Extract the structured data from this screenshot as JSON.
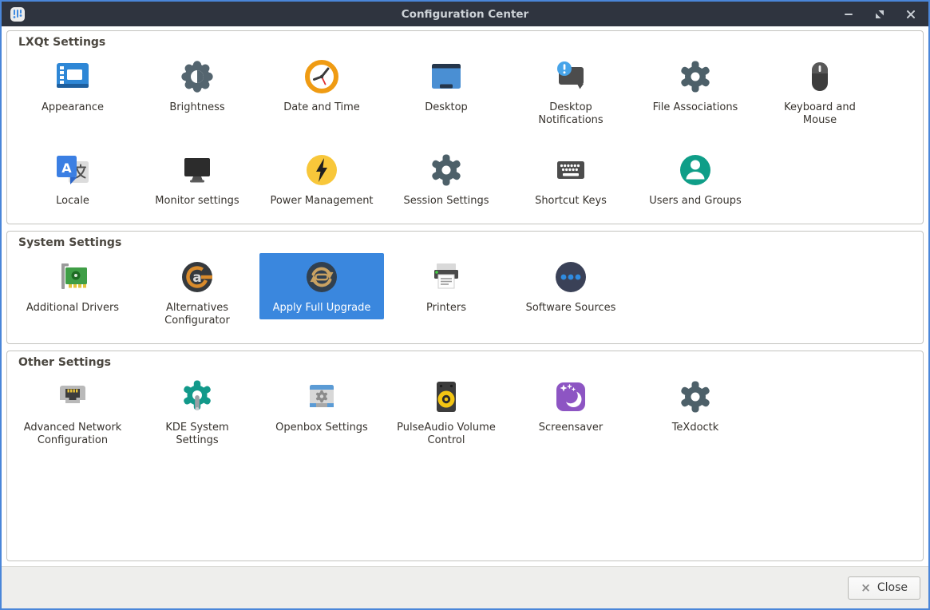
{
  "window": {
    "title": "Configuration Center",
    "controls": {
      "minimize": "minimize",
      "maximize": "maximize",
      "close": "close"
    }
  },
  "colors": {
    "titlebar_bg": "#2f343f",
    "titlebar_text": "#ced3d8",
    "window_border": "#4a86d9",
    "content_bg": "#ffffff",
    "section_border": "#c3c3bf",
    "section_title_text": "#4b4740",
    "item_label_text": "#37332e",
    "selection_bg": "#3a87de",
    "selection_text": "#ffffff",
    "footer_bg": "#eeeeec"
  },
  "sections": [
    {
      "title": "LXQt Settings",
      "items": [
        {
          "label": "Appearance",
          "icon": "appearance-icon"
        },
        {
          "label": "Brightness",
          "icon": "brightness-icon"
        },
        {
          "label": "Date and Time",
          "icon": "clock-icon"
        },
        {
          "label": "Desktop",
          "icon": "desktop-icon"
        },
        {
          "label": "Desktop Notifications",
          "icon": "notification-bubble-icon"
        },
        {
          "label": "File Associations",
          "icon": "gear-icon"
        },
        {
          "label": "Keyboard and Mouse",
          "icon": "mouse-icon"
        },
        {
          "label": "Locale",
          "icon": "translate-icon"
        },
        {
          "label": "Monitor settings",
          "icon": "monitor-icon"
        },
        {
          "label": "Power Management",
          "icon": "lightning-bolt-icon"
        },
        {
          "label": "Session Settings",
          "icon": "gear-icon"
        },
        {
          "label": "Shortcut Keys",
          "icon": "keyboard-icon"
        },
        {
          "label": "Users and Groups",
          "icon": "user-circle-icon"
        }
      ]
    },
    {
      "title": "System Settings",
      "items": [
        {
          "label": "Additional Drivers",
          "icon": "driver-card-icon"
        },
        {
          "label": "Alternatives Configurator",
          "icon": "alternatives-icon"
        },
        {
          "label": "Apply Full Upgrade",
          "icon": "upgrade-refresh-icon",
          "selected": true
        },
        {
          "label": "Printers",
          "icon": "printer-icon"
        },
        {
          "label": "Software Sources",
          "icon": "software-sources-icon"
        }
      ]
    },
    {
      "title": "Other Settings",
      "items": [
        {
          "label": "Advanced Network Configuration",
          "icon": "ethernet-port-icon"
        },
        {
          "label": "KDE System Settings",
          "icon": "gear-wrench-icon"
        },
        {
          "label": "Openbox Settings",
          "icon": "window-gear-icon"
        },
        {
          "label": "PulseAudio Volume Control",
          "icon": "speaker-icon"
        },
        {
          "label": "Screensaver",
          "icon": "moon-stars-icon"
        },
        {
          "label": "TeXdoctk",
          "icon": "gear-icon"
        }
      ]
    }
  ],
  "footer": {
    "close_label": "Close",
    "close_icon": "×"
  }
}
